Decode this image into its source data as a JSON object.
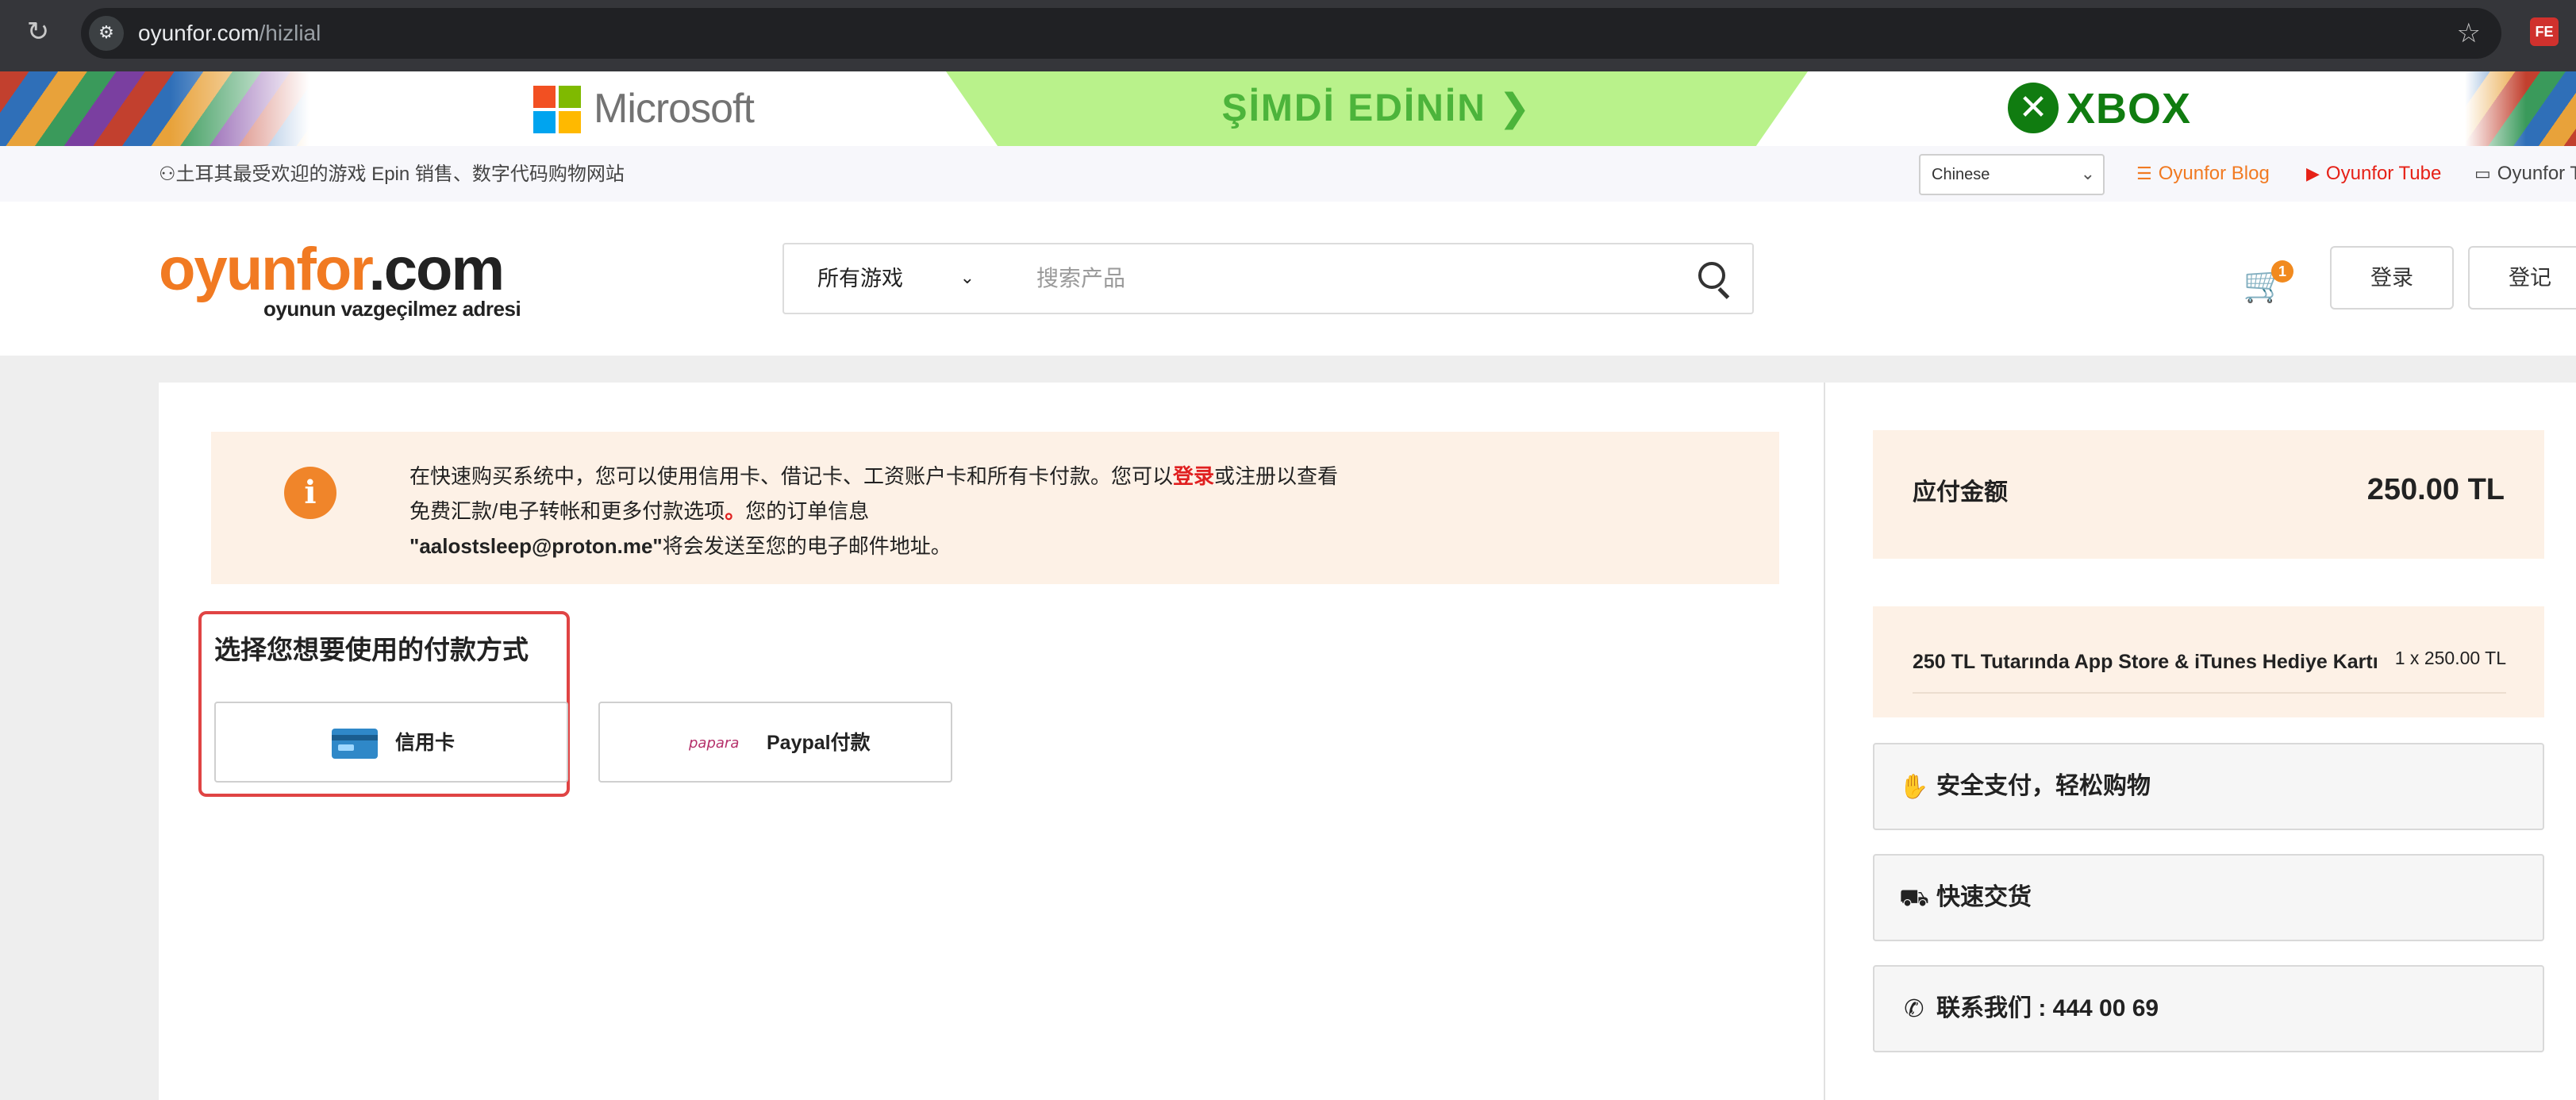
{
  "browser": {
    "url_host": "oyunfor.com",
    "url_path": "/hizlial",
    "extension_label": "FE"
  },
  "banner": {
    "microsoft_label": "Microsoft",
    "promo_label": "ŞİMDİ EDİNİN ❯",
    "xbox_label": "XBOX"
  },
  "topbar": {
    "tagline": "土耳其最受欢迎的游戏 Epin 销售、数字代码购物网站",
    "language": "Chinese",
    "blog_label": "Oyunfor Blog",
    "tube_label": "Oyunfor Tube",
    "twitch_label": "Oyunfor T"
  },
  "header": {
    "logo_main_orange": "oyunfor",
    "logo_main_dark": ".com",
    "logo_sub": "oyunun vazgeçilmez adresi",
    "category": "所有游戏",
    "search_placeholder": "搜索产品",
    "cart_count": "1",
    "login_label": "登录",
    "register_label": "登记"
  },
  "notice": {
    "line1_a": "在快速购买系统中，您可以使用信用卡、借记卡、工资账户卡和所有卡付款。您可以",
    "line1_link": "登录",
    "line1_b": "或注册以查看",
    "line2_a": "免费汇款/电子转帐和更多付款选项",
    "line2_dot": "。",
    "line2_b": "您的订单信息",
    "line3_email": "\"aalostsleep@proton.me\"",
    "line3_b": "将会发送至您的电子邮件地址。"
  },
  "payment": {
    "title": "选择您想要使用的付款方式",
    "credit_card_label": "信用卡",
    "papara_logo_text": "papara",
    "paypal_label": "Paypal付款"
  },
  "summary": {
    "amount_label": "应付金额",
    "amount_value": "250.00 TL",
    "item_name": "250 TL Tutarında App Store & iTunes Hediye Kartı",
    "item_qty": "1 x 250.00 TL",
    "features": [
      {
        "icon": "hand-coin-icon",
        "label": "安全支付，轻松购物"
      },
      {
        "icon": "truck-icon",
        "label": "快速交货"
      },
      {
        "icon": "phone-icon",
        "label": "联系我们 : 444 00 69"
      }
    ]
  },
  "colors": {
    "brand_orange": "#f17a22",
    "notice_bg": "#fdf1e6",
    "selection_border": "#e04444",
    "link_red": "#e02020",
    "xbox_green": "#107c10",
    "promo_green": "#b9f28b"
  }
}
